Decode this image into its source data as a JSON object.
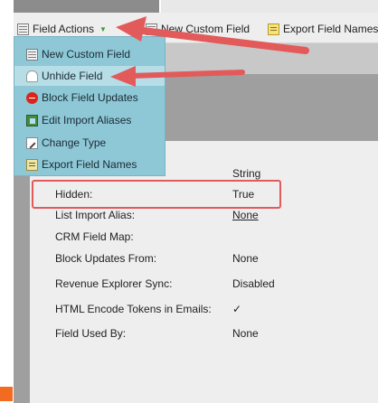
{
  "toolbar": {
    "field_actions_label": "Field Actions",
    "new_custom_field_label": "New Custom Field",
    "export_field_names_label": "Export Field Names"
  },
  "menu": {
    "items": [
      {
        "label": "New Custom Field",
        "icon": "table-icon"
      },
      {
        "label": "Unhide Field",
        "icon": "ghost-icon"
      },
      {
        "label": "Block Field Updates",
        "icon": "block-icon"
      },
      {
        "label": "Edit Import Aliases",
        "icon": "edit-icon"
      },
      {
        "label": "Change Type",
        "icon": "change-icon"
      },
      {
        "label": "Export Field Names",
        "icon": "export-icon"
      }
    ]
  },
  "details": {
    "type_value": "String",
    "rows": [
      {
        "label": "Hidden:",
        "value": "True"
      },
      {
        "label": "List Import Alias:",
        "value": "None"
      },
      {
        "label": "CRM Field Map:",
        "value": ""
      },
      {
        "label": "Block Updates From:",
        "value": "None"
      },
      {
        "label": "Revenue Explorer Sync:",
        "value": "Disabled"
      },
      {
        "label": "HTML Encode Tokens in Emails:",
        "value": "✓"
      },
      {
        "label": "Field Used By:",
        "value": "None"
      }
    ]
  },
  "colors": {
    "menu_bg": "#8ec8d6",
    "annotation_red": "#e25a5a",
    "accent_orange": "#f26b21"
  }
}
